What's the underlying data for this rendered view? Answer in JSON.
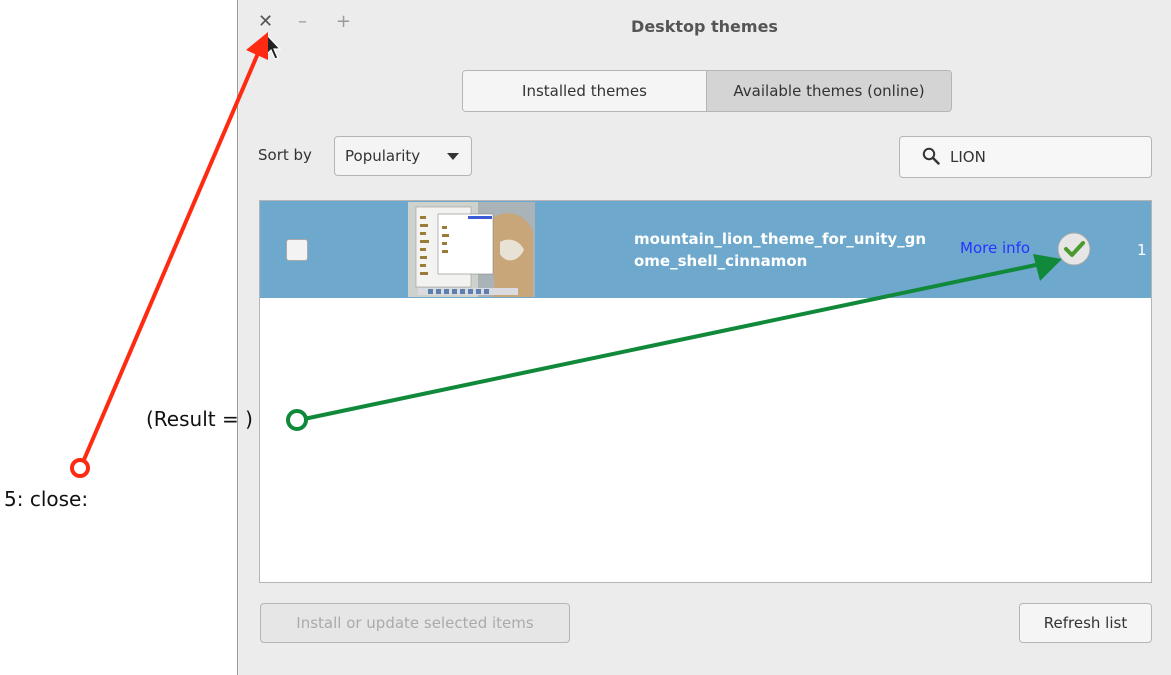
{
  "window": {
    "title": "Desktop themes",
    "close_glyph": "✕",
    "minimize_glyph": "–",
    "maximize_glyph": "+"
  },
  "tabs": [
    {
      "label": "Installed themes",
      "selected": false
    },
    {
      "label": "Available themes (online)",
      "selected": true
    }
  ],
  "sort": {
    "label": "Sort by",
    "value": "Popularity"
  },
  "search": {
    "value": "LION",
    "icon": "search-icon"
  },
  "themes": [
    {
      "name": "mountain_lion_theme_for_unity_gnome_shell_cinnamon",
      "more_info": "More info",
      "installed_icon": "checkmark-icon",
      "count": "1",
      "checked": false
    }
  ],
  "buttons": {
    "install": "Install or update selected items",
    "refresh": "Refresh list"
  },
  "annotations": {
    "close_step": "5: close:",
    "result": "(Result = )"
  },
  "colors": {
    "selection": "#6ea8cd",
    "annotation_red": "#ff2a12",
    "annotation_green": "#11893a"
  }
}
